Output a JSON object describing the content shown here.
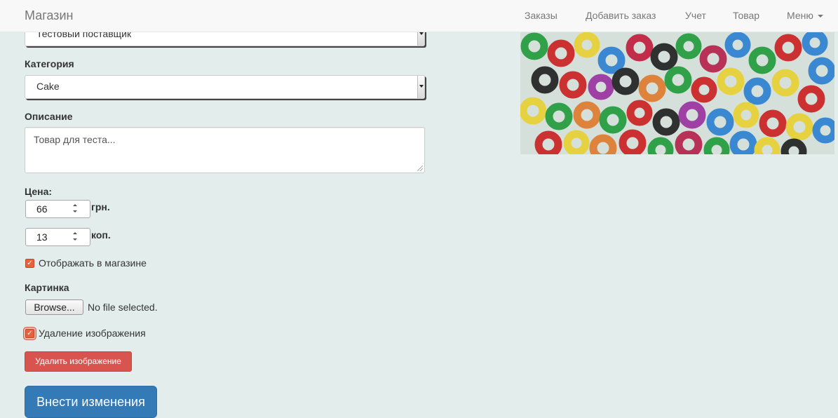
{
  "navbar": {
    "brand": "Магазин",
    "links": [
      "Заказы",
      "Добавить заказ",
      "Учет",
      "Товар",
      "Меню"
    ]
  },
  "form": {
    "supplier_value": "Тестовый поставщик",
    "category_label": "Категория",
    "category_value": "Cake",
    "description_label": "Описание",
    "description_value": "Товар для теста...",
    "price_label": "Цена:",
    "price_uah": "66",
    "price_uah_unit": "грн.",
    "price_kop": "13",
    "price_kop_unit": "коп.",
    "show_in_store_label": "Отображать в магазине",
    "show_in_store_checked": true,
    "image_label": "Картинка",
    "browse_button": "Browse...",
    "file_status": "No file selected.",
    "delete_image_label": "Удаление изображения",
    "delete_image_checked": true,
    "delete_image_button": "Удалить изображение",
    "submit_button": "Внести изменения"
  },
  "colors": {
    "accent_primary": "#337ab7",
    "accent_danger": "#d9534f",
    "checkbox": "#e8603c",
    "background": "#e3eeec"
  },
  "icons": {
    "menu_caret": "chevron-down-icon",
    "select_arrow": "chevron-down-icon",
    "spinner": "spinner-arrows-icon",
    "checkmark": "checkmark-icon"
  }
}
